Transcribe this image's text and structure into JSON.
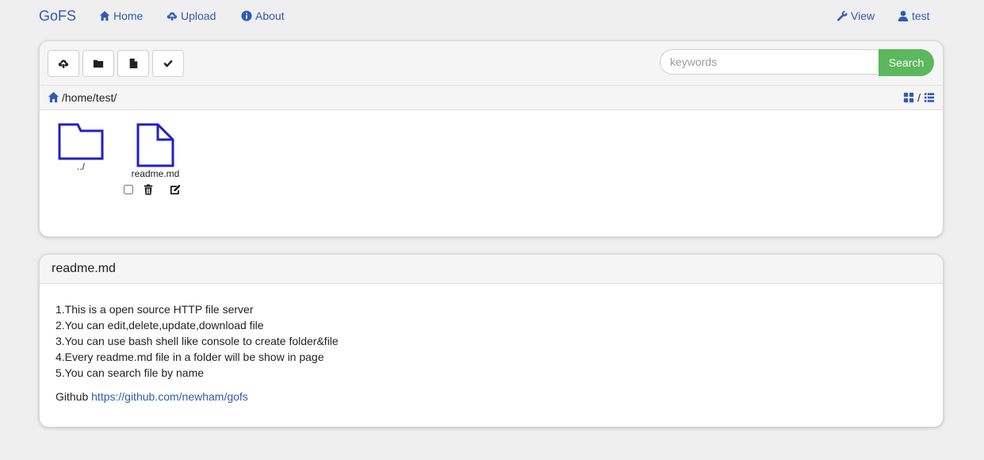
{
  "nav": {
    "brand": "GoFS",
    "home": "Home",
    "upload": "Upload",
    "about": "About",
    "view": "View",
    "user": "test"
  },
  "toolbar": {
    "buttons": [
      "upload-cloud-icon",
      "folder-icon",
      "file-icon",
      "check-icon"
    ],
    "search_placeholder": "keywords",
    "search_label": "Search"
  },
  "path": {
    "current": "/home/test/",
    "view_separator": "/"
  },
  "files": [
    {
      "name": "../",
      "type": "folder"
    },
    {
      "name": "readme.md",
      "type": "file"
    }
  ],
  "readme": {
    "title": "readme.md",
    "lines": [
      "1.This is a open source HTTP file server",
      "2.You can edit,delete,update,download file",
      "3.You can use bash shell like console to create folder&file",
      "4.Every readme.md file in a folder will be show in page",
      "5.You can search file by name"
    ],
    "github_label": "Github",
    "github_link": "https://github.com/newham/gofs"
  },
  "colors": {
    "accent": "#2f5bb5",
    "search_button": "#5cb85c",
    "file_icon": "#2020c8",
    "background": "#efefef"
  }
}
